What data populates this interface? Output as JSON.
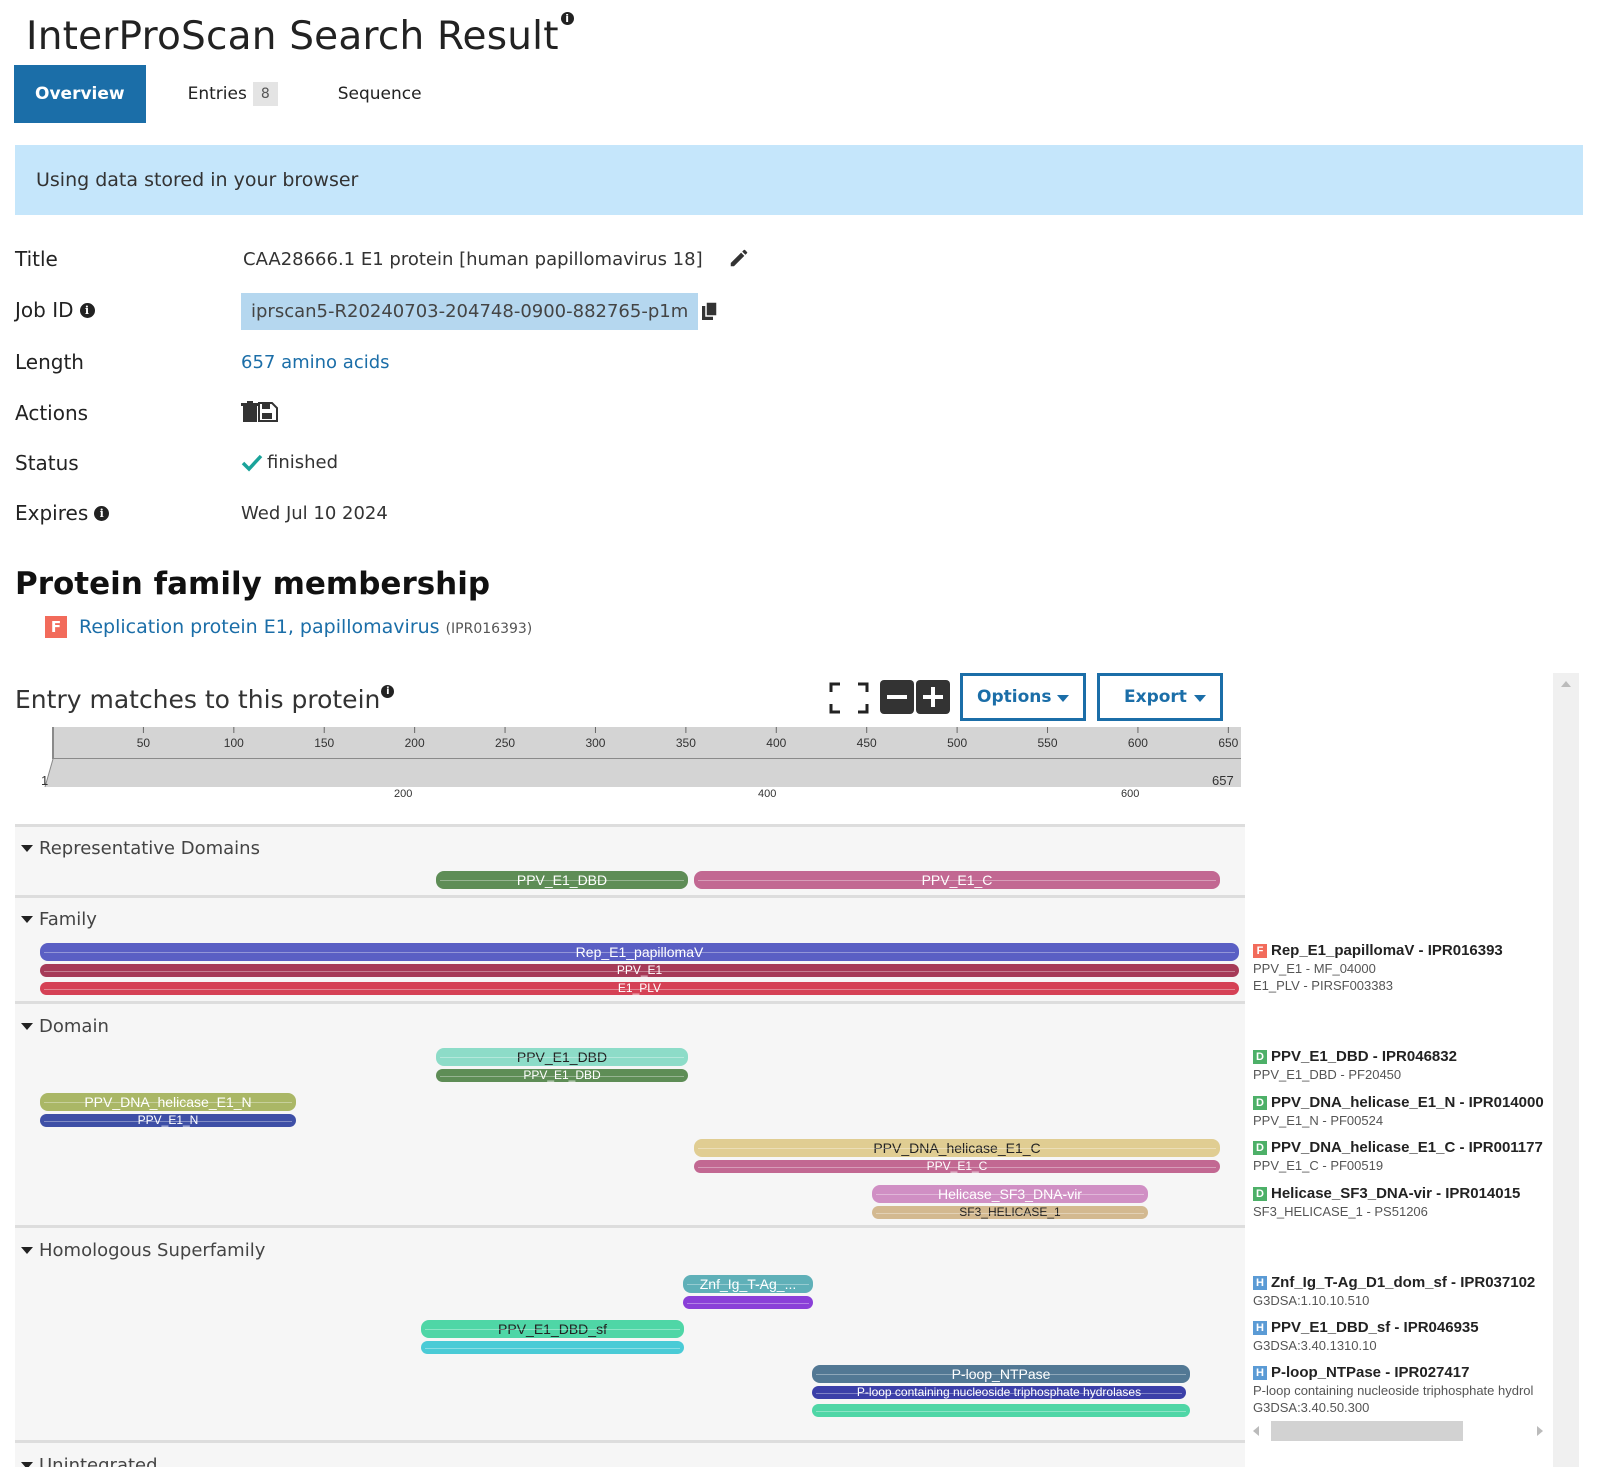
{
  "page": {
    "title": "InterProScan Search Result",
    "title_info": "i"
  },
  "tabs": [
    {
      "label": "Overview"
    },
    {
      "label": "Entries",
      "count": "8"
    },
    {
      "label": "Sequence"
    }
  ],
  "banner": {
    "text": "Using data stored in your browser"
  },
  "meta": {
    "title_label": "Title",
    "title_value": "CAA28666.1 E1 protein [human papillomavirus 18]",
    "jobid_label": "Job ID",
    "jobid_value": "iprscan5-R20240703-204748-0900-882765-p1m",
    "length_label": "Length",
    "length_value": "657 amino acids",
    "actions_label": "Actions",
    "status_label": "Status",
    "status_value": "finished",
    "expires_label": "Expires",
    "expires_value": "Wed Jul 10 2024"
  },
  "family": {
    "heading": "Protein family membership",
    "badge": "F",
    "name": "Replication protein E1, papillomavirus",
    "accession": "(IPR016393)"
  },
  "matches": {
    "heading": "Entry matches to this protein",
    "options_label": "Options",
    "export_label": "Export",
    "ruler": {
      "ticks": [
        "50",
        "100",
        "150",
        "200",
        "250",
        "300",
        "350",
        "400",
        "450",
        "500",
        "550",
        "600",
        "650"
      ],
      "start": "1",
      "end": "657",
      "minor": [
        "200",
        "400",
        "600"
      ]
    },
    "tracks": {
      "representative": "Representative Domains",
      "family": "Family",
      "domain": "Domain",
      "homologous": "Homologous Superfamily",
      "unintegrated": "Unintegrated"
    },
    "bars": {
      "rep_dbd": "PPV_E1_DBD",
      "rep_c": "PPV_E1_C",
      "fam_rep": "Rep_E1_papillomaV",
      "fam_ppv": "PPV_E1",
      "fam_plv": "E1_PLV",
      "dom_dbd": "PPV_E1_DBD",
      "dom_dbd2": "PPV_E1_DBD",
      "dom_n": "PPV_DNA_helicase_E1_N",
      "dom_n2": "PPV_E1_N",
      "dom_c": "PPV_DNA_helicase_E1_C",
      "dom_c2": "PPV_E1_C",
      "dom_hel": "Helicase_SF3_DNA-vir",
      "dom_hel2": "SF3_HELICASE_1",
      "hs_znf": "Znf_Ig_T-Ag_...",
      "hs_dbd": "PPV_E1_DBD_sf",
      "hs_ploop": "P-loop_NTPase",
      "hs_ploop2": "P-loop containing nucleoside triphosphate hydrolases"
    },
    "legend": [
      {
        "badge": "F",
        "title": "Rep_E1_papillomaV - IPR016393",
        "lines": [
          "PPV_E1 - MF_04000",
          "E1_PLV - PIRSF003383"
        ]
      },
      {
        "badge": "D",
        "title": "PPV_E1_DBD - IPR046832",
        "lines": [
          "PPV_E1_DBD - PF20450"
        ]
      },
      {
        "badge": "D",
        "title": "PPV_DNA_helicase_E1_N - IPR014000",
        "lines": [
          "PPV_E1_N - PF00524"
        ]
      },
      {
        "badge": "D",
        "title": "PPV_DNA_helicase_E1_C - IPR001177",
        "lines": [
          "PPV_E1_C - PF00519"
        ]
      },
      {
        "badge": "D",
        "title": "Helicase_SF3_DNA-vir - IPR014015",
        "lines": [
          "SF3_HELICASE_1 - PS51206"
        ]
      },
      {
        "badge": "H",
        "title": "Znf_Ig_T-Ag_D1_dom_sf - IPR037102",
        "lines": [
          "G3DSA:1.10.10.510"
        ]
      },
      {
        "badge": "H",
        "title": "PPV_E1_DBD_sf - IPR046935",
        "lines": [
          "G3DSA:3.40.1310.10"
        ]
      },
      {
        "badge": "H",
        "title": "P-loop_NTPase - IPR027417",
        "lines": [
          "P-loop containing nucleoside triphosphate hydrol",
          "G3DSA:3.40.50.300"
        ]
      }
    ]
  }
}
